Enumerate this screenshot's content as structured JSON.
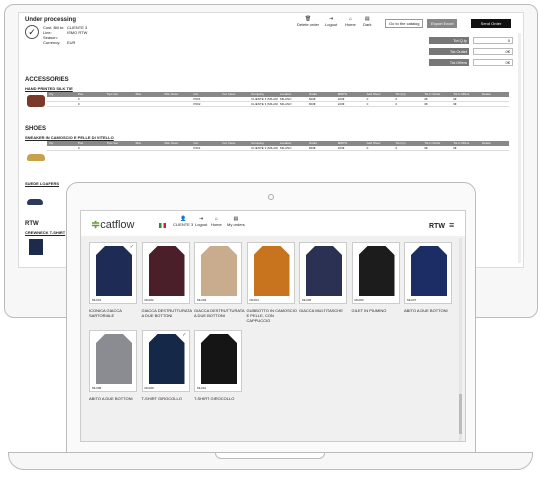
{
  "order": {
    "title": "Under processing",
    "fields": [
      {
        "label": "Cust. Bill to:",
        "value": "CLIENTE 3"
      },
      {
        "label": "Line:",
        "value": "ISMO RTW"
      },
      {
        "label": "Season:",
        "value": ""
      },
      {
        "label": "Currency:",
        "value": "EUR"
      }
    ],
    "toolbar": {
      "delete": "Delete order",
      "logout": "Logout",
      "home": "Home",
      "dark": "Dark",
      "catalog": "Go to the catalog",
      "export": "Export Excel",
      "send": "Send Order"
    },
    "totals": [
      {
        "label": "Tot.Q.ty",
        "value": "0"
      },
      {
        "label": "Tot.Outlet",
        "value": "0€"
      },
      {
        "label": "Tot.Offers",
        "value": "0€"
      }
    ],
    "accessories": {
      "title": "ACCESSORIES",
      "item": "HAND PRINTED SILK TIE",
      "headers": [
        "Vty",
        "Pos.",
        "Tipo Var.",
        "Mat.",
        "Mat. Desc.",
        "Col.",
        "Col. Desc.",
        "Company",
        "Location",
        "Outlet",
        "MRP%",
        "Add Show",
        "Tot.Q.ty",
        "Tot.C.Outlet",
        "Tot.C.Offers",
        "Delete"
      ],
      "rows": [
        [
          "",
          "0",
          "",
          "",
          "",
          "P001",
          "",
          "CLIENTE 3 (MILANO)",
          "MILANO",
          "600€",
          "220€",
          "0",
          "0",
          "0€",
          "0€",
          ""
        ],
        [
          "",
          "0",
          "",
          "",
          "",
          "P002",
          "",
          "CLIENTE 3 (MILANO)",
          "MILANO",
          "600€",
          "220€",
          "0",
          "0",
          "0€",
          "0€",
          ""
        ]
      ]
    },
    "shoes": {
      "title": "SHOES",
      "item": "SNEAKER IN CAMOSCIO E PELLE DI VITELLO",
      "headers": [
        "Vty",
        "Pos.",
        "Tipo Var.",
        "Mat.",
        "Mat. Desc.",
        "Col.",
        "Col. Desc.",
        "Company",
        "Location",
        "Outlet",
        "MRP%",
        "Add Show",
        "Tot.Q.ty",
        "Tot.C.Outlet",
        "Tot.C.Offers",
        "Delete"
      ],
      "rows": [
        [
          "",
          "0",
          "",
          "",
          "",
          "P001",
          "",
          "CLIENTE 3 (MILANO)",
          "MILANO",
          "600€",
          "220€",
          "0",
          "0",
          "0€",
          "0€",
          ""
        ]
      ],
      "item2": "SUEDE LOAFERS"
    },
    "rtw": {
      "title": "RTW",
      "item": "CREWNECK T-SHIRT"
    }
  },
  "catalog": {
    "logo": "catflow",
    "nav": {
      "user": "CLIENTE 3",
      "logout": "Logout",
      "home": "Home",
      "orders": "My orders"
    },
    "line": "RTW",
    "products": [
      {
        "code": "ML001",
        "name": "ICONICA GIACCA SARTORIALE",
        "color": "#1e2b55",
        "checked": true
      },
      {
        "code": "ML002",
        "name": "GIACCA DESTRUTTURATA A DUE BOTTONI",
        "color": "#4a1f2a",
        "checked": false
      },
      {
        "code": "ML003",
        "name": "GIACCA DESTRUTTURATA A DUE BOTTONI",
        "color": "#c9ab8e",
        "checked": false
      },
      {
        "code": "ML004",
        "name": "GUBBOTTO IN CAMOSCIO E PELLE, CON CAPPUCCIO",
        "color": "#c8741f",
        "checked": false
      },
      {
        "code": "ML005",
        "name": "GIACCA MULTITASCHE",
        "color": "#2b3152",
        "checked": false
      },
      {
        "code": "ML006",
        "name": "GILET IN PIUMINO",
        "color": "#1c1c1c",
        "checked": false
      },
      {
        "code": "ML007",
        "name": "ABITO A DUE BOTTONI",
        "color": "#1c2d66",
        "checked": false
      },
      {
        "code": "ML008",
        "name": "ABITO A DUE BOTTONI",
        "color": "#8a8c92",
        "checked": false
      },
      {
        "code": "ML009",
        "name": "T-SHIRT GIROCOLLO",
        "color": "#152848",
        "checked": true
      },
      {
        "code": "ML010",
        "name": "T-SHIRT GIROCOLLO",
        "color": "#151515",
        "checked": false
      }
    ]
  },
  "colors": {
    "accent": "#c8ddb0",
    "brand": "#6a9a3a",
    "dark": "#111111"
  }
}
